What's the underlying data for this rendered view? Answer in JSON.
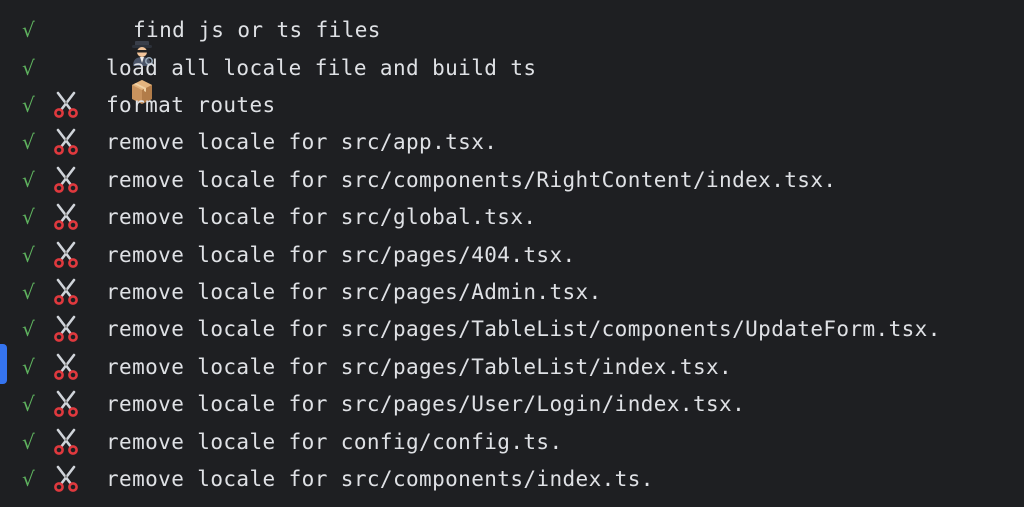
{
  "colors": {
    "background": "#1e1f22",
    "text": "#dfe1e5",
    "check": "#5fb35f",
    "scroll_marker": "#3574f0"
  },
  "lines": [
    {
      "status": "√",
      "icon": "detective-icon",
      "text": "find js or ts files"
    },
    {
      "status": "√",
      "icon": "package-icon",
      "text": "load all locale file and build ts"
    },
    {
      "status": "√",
      "icon": "scissors-icon",
      "text": "format routes"
    },
    {
      "status": "√",
      "icon": "scissors-icon",
      "text": "remove locale for src/app.tsx."
    },
    {
      "status": "√",
      "icon": "scissors-icon",
      "text": "remove locale for src/components/RightContent/index.tsx."
    },
    {
      "status": "√",
      "icon": "scissors-icon",
      "text": "remove locale for src/global.tsx."
    },
    {
      "status": "√",
      "icon": "scissors-icon",
      "text": "remove locale for src/pages/404.tsx."
    },
    {
      "status": "√",
      "icon": "scissors-icon",
      "text": "remove locale for src/pages/Admin.tsx."
    },
    {
      "status": "√",
      "icon": "scissors-icon",
      "text": "remove locale for src/pages/TableList/components/UpdateForm.tsx."
    },
    {
      "status": "√",
      "icon": "scissors-icon",
      "text": "remove locale for src/pages/TableList/index.tsx."
    },
    {
      "status": "√",
      "icon": "scissors-icon",
      "text": "remove locale for src/pages/User/Login/index.tsx."
    },
    {
      "status": "√",
      "icon": "scissors-icon",
      "text": "remove locale for config/config.ts."
    },
    {
      "status": "√",
      "icon": "scissors-icon",
      "text": "remove locale for src/components/index.ts."
    }
  ]
}
